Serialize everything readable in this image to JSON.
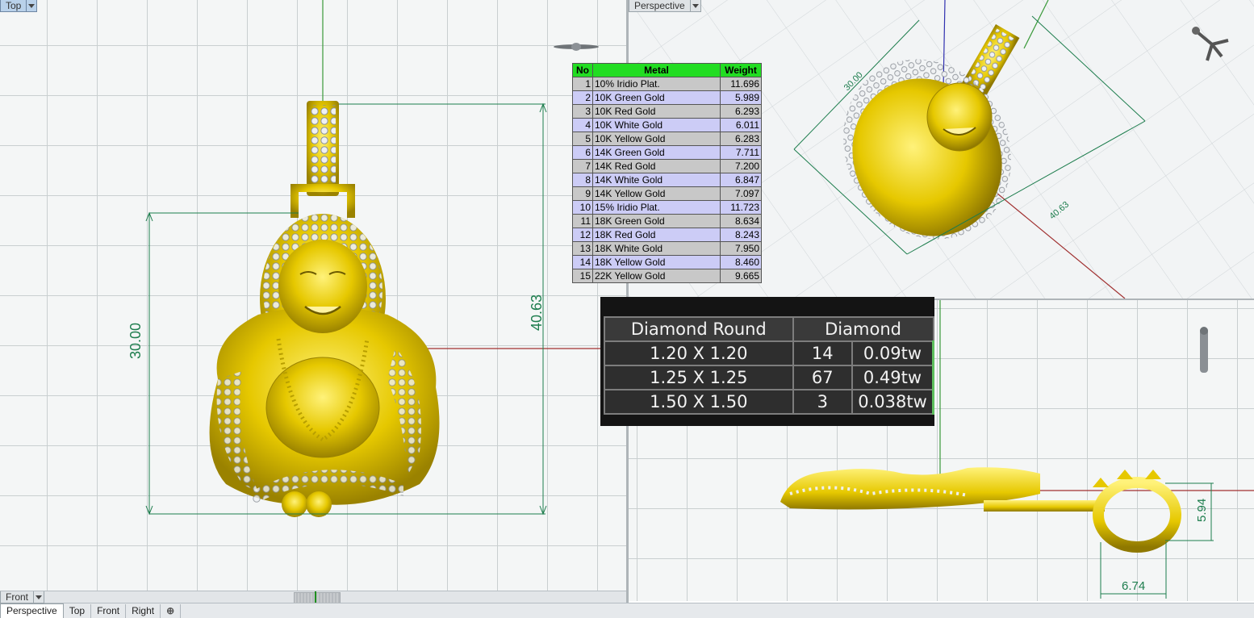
{
  "viewports": {
    "top_label": "Top",
    "perspective_label": "Perspective",
    "front_label": "Front"
  },
  "dimensions": {
    "top_height_inner": "30.00",
    "top_height_outer": "40.63",
    "persp_a": "30.00",
    "persp_b": "40.63",
    "right_height": "5.94",
    "right_width": "6.74"
  },
  "metal_table": {
    "headers": [
      "No",
      "Metal",
      "Weight"
    ],
    "rows": [
      {
        "no": "1",
        "metal": "10% Iridio Plat.",
        "weight": "11.696"
      },
      {
        "no": "2",
        "metal": "10K Green Gold",
        "weight": "5.989"
      },
      {
        "no": "3",
        "metal": "10K Red Gold",
        "weight": "6.293"
      },
      {
        "no": "4",
        "metal": "10K White Gold",
        "weight": "6.011"
      },
      {
        "no": "5",
        "metal": "10K Yellow Gold",
        "weight": "6.283"
      },
      {
        "no": "6",
        "metal": "14K Green Gold",
        "weight": "7.711"
      },
      {
        "no": "7",
        "metal": "14K Red Gold",
        "weight": "7.200"
      },
      {
        "no": "8",
        "metal": "14K White Gold",
        "weight": "6.847"
      },
      {
        "no": "9",
        "metal": "14K Yellow Gold",
        "weight": "7.097"
      },
      {
        "no": "10",
        "metal": "15% Iridio Plat.",
        "weight": "11.723"
      },
      {
        "no": "11",
        "metal": "18K Green Gold",
        "weight": "8.634"
      },
      {
        "no": "12",
        "metal": "18K Red Gold",
        "weight": "8.243"
      },
      {
        "no": "13",
        "metal": "18K White Gold",
        "weight": "7.950"
      },
      {
        "no": "14",
        "metal": "18K Yellow Gold",
        "weight": "8.460"
      },
      {
        "no": "15",
        "metal": "22K Yellow Gold",
        "weight": "9.665"
      }
    ]
  },
  "diamond_table": {
    "header_left": "Diamond Round",
    "header_right": "Diamond",
    "rows": [
      {
        "size": "1.20 X 1.20",
        "count": "14",
        "weight": "0.09tw"
      },
      {
        "size": "1.25 X 1.25",
        "count": "67",
        "weight": "0.49tw"
      },
      {
        "size": "1.50 X 1.50",
        "count": "3",
        "weight": "0.038tw"
      }
    ]
  },
  "tabs": [
    "Perspective",
    "Top",
    "Front",
    "Right"
  ],
  "tab_add": "⊕",
  "icons": [
    "dropdown-arrow-icon",
    "navigation-figure-icon"
  ],
  "colors": {
    "gold": "#e6c800",
    "dimension": "#1d7d4d",
    "table_header": "#22dd22"
  }
}
